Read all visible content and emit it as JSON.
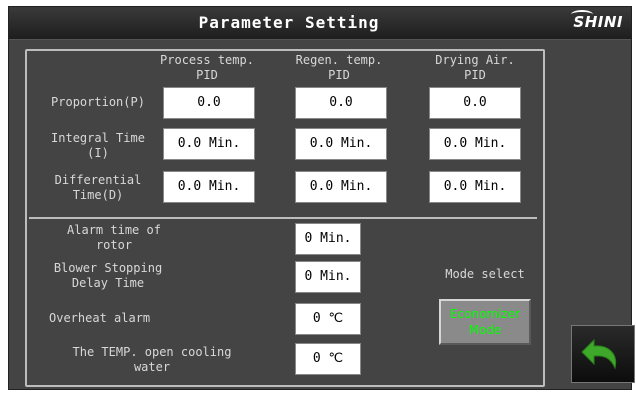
{
  "header": {
    "title": "Parameter Setting",
    "logo_text": "SHINI"
  },
  "pid": {
    "columns": [
      "Process temp.\nPID",
      "Regen. temp.\nPID",
      "Drying Air.\nPID"
    ],
    "rows": [
      {
        "label": "Proportion(P)",
        "values": [
          "0.0",
          "0.0",
          "0.0"
        ]
      },
      {
        "label": "Integral Time\n(I)",
        "values": [
          "0.0 Min.",
          "0.0 Min.",
          "0.0 Min."
        ]
      },
      {
        "label": "Differential\nTime(D)",
        "values": [
          "0.0 Min.",
          "0.0 Min.",
          "0.0 Min."
        ]
      }
    ]
  },
  "settings": [
    {
      "label": "Alarm time of\nrotor",
      "value": "0 Min."
    },
    {
      "label": "Blower Stopping\nDelay Time",
      "value": "0 Min."
    },
    {
      "label": "Overheat alarm",
      "value": "0 ℃"
    },
    {
      "label": "The TEMP. open cooling\nwater",
      "value": "0 ℃"
    }
  ],
  "mode": {
    "label": "Mode select",
    "button_label": "Economizer\nMode",
    "button_text_color": "#00ff00"
  },
  "nav": {
    "back_icon": "return-arrow-icon",
    "back_icon_color": "#3ea82a"
  }
}
